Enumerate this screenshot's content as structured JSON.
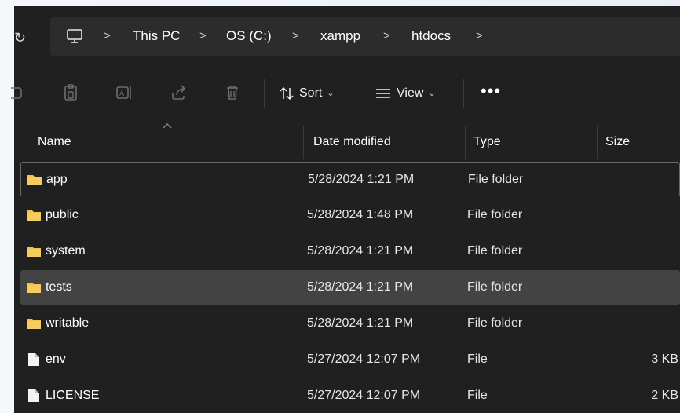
{
  "address": {
    "breadcrumbs": [
      {
        "label": "This PC"
      },
      {
        "label": "OS (C:)"
      },
      {
        "label": "xampp"
      },
      {
        "label": "htdocs"
      }
    ]
  },
  "toolbar": {
    "sort_label": "Sort",
    "view_label": "View",
    "more_label": "•••"
  },
  "columns": {
    "name": "Name",
    "date": "Date modified",
    "type": "Type",
    "size": "Size"
  },
  "files": [
    {
      "name": "app",
      "date": "5/28/2024 1:21 PM",
      "type": "File folder",
      "size": "",
      "icon": "folder-icon"
    },
    {
      "name": "public",
      "date": "5/28/2024 1:48 PM",
      "type": "File folder",
      "size": "",
      "icon": "folder-icon"
    },
    {
      "name": "system",
      "date": "5/28/2024 1:21 PM",
      "type": "File folder",
      "size": "",
      "icon": "folder-icon"
    },
    {
      "name": "tests",
      "date": "5/28/2024 1:21 PM",
      "type": "File folder",
      "size": "",
      "icon": "folder-icon"
    },
    {
      "name": "writable",
      "date": "5/28/2024 1:21 PM",
      "type": "File folder",
      "size": "",
      "icon": "folder-icon"
    },
    {
      "name": "env",
      "date": "5/27/2024 12:07 PM",
      "type": "File",
      "size": "3 KB",
      "icon": "file-icon"
    },
    {
      "name": "LICENSE",
      "date": "5/27/2024 12:07 PM",
      "type": "File",
      "size": "2 KB",
      "icon": "file-icon"
    }
  ],
  "colors": {
    "window_bg": "#202020",
    "address_bg": "#2c2c2c",
    "selected_row": "#434343",
    "folder": "#f2c14e"
  }
}
